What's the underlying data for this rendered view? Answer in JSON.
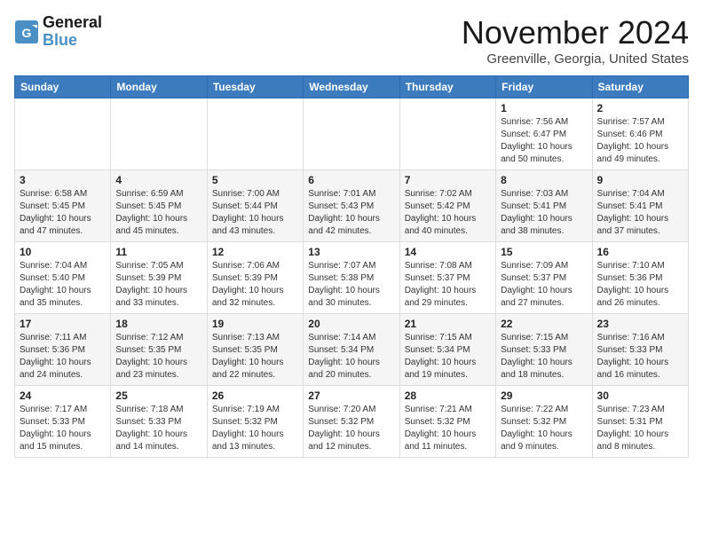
{
  "logo": {
    "line1": "General",
    "line2": "Blue"
  },
  "title": "November 2024",
  "location": "Greenville, Georgia, United States",
  "weekdays": [
    "Sunday",
    "Monday",
    "Tuesday",
    "Wednesday",
    "Thursday",
    "Friday",
    "Saturday"
  ],
  "weeks": [
    [
      {
        "day": "",
        "detail": ""
      },
      {
        "day": "",
        "detail": ""
      },
      {
        "day": "",
        "detail": ""
      },
      {
        "day": "",
        "detail": ""
      },
      {
        "day": "",
        "detail": ""
      },
      {
        "day": "1",
        "detail": "Sunrise: 7:56 AM\nSunset: 6:47 PM\nDaylight: 10 hours\nand 50 minutes."
      },
      {
        "day": "2",
        "detail": "Sunrise: 7:57 AM\nSunset: 6:46 PM\nDaylight: 10 hours\nand 49 minutes."
      }
    ],
    [
      {
        "day": "3",
        "detail": "Sunrise: 6:58 AM\nSunset: 5:45 PM\nDaylight: 10 hours\nand 47 minutes."
      },
      {
        "day": "4",
        "detail": "Sunrise: 6:59 AM\nSunset: 5:45 PM\nDaylight: 10 hours\nand 45 minutes."
      },
      {
        "day": "5",
        "detail": "Sunrise: 7:00 AM\nSunset: 5:44 PM\nDaylight: 10 hours\nand 43 minutes."
      },
      {
        "day": "6",
        "detail": "Sunrise: 7:01 AM\nSunset: 5:43 PM\nDaylight: 10 hours\nand 42 minutes."
      },
      {
        "day": "7",
        "detail": "Sunrise: 7:02 AM\nSunset: 5:42 PM\nDaylight: 10 hours\nand 40 minutes."
      },
      {
        "day": "8",
        "detail": "Sunrise: 7:03 AM\nSunset: 5:41 PM\nDaylight: 10 hours\nand 38 minutes."
      },
      {
        "day": "9",
        "detail": "Sunrise: 7:04 AM\nSunset: 5:41 PM\nDaylight: 10 hours\nand 37 minutes."
      }
    ],
    [
      {
        "day": "10",
        "detail": "Sunrise: 7:04 AM\nSunset: 5:40 PM\nDaylight: 10 hours\nand 35 minutes."
      },
      {
        "day": "11",
        "detail": "Sunrise: 7:05 AM\nSunset: 5:39 PM\nDaylight: 10 hours\nand 33 minutes."
      },
      {
        "day": "12",
        "detail": "Sunrise: 7:06 AM\nSunset: 5:39 PM\nDaylight: 10 hours\nand 32 minutes."
      },
      {
        "day": "13",
        "detail": "Sunrise: 7:07 AM\nSunset: 5:38 PM\nDaylight: 10 hours\nand 30 minutes."
      },
      {
        "day": "14",
        "detail": "Sunrise: 7:08 AM\nSunset: 5:37 PM\nDaylight: 10 hours\nand 29 minutes."
      },
      {
        "day": "15",
        "detail": "Sunrise: 7:09 AM\nSunset: 5:37 PM\nDaylight: 10 hours\nand 27 minutes."
      },
      {
        "day": "16",
        "detail": "Sunrise: 7:10 AM\nSunset: 5:36 PM\nDaylight: 10 hours\nand 26 minutes."
      }
    ],
    [
      {
        "day": "17",
        "detail": "Sunrise: 7:11 AM\nSunset: 5:36 PM\nDaylight: 10 hours\nand 24 minutes."
      },
      {
        "day": "18",
        "detail": "Sunrise: 7:12 AM\nSunset: 5:35 PM\nDaylight: 10 hours\nand 23 minutes."
      },
      {
        "day": "19",
        "detail": "Sunrise: 7:13 AM\nSunset: 5:35 PM\nDaylight: 10 hours\nand 22 minutes."
      },
      {
        "day": "20",
        "detail": "Sunrise: 7:14 AM\nSunset: 5:34 PM\nDaylight: 10 hours\nand 20 minutes."
      },
      {
        "day": "21",
        "detail": "Sunrise: 7:15 AM\nSunset: 5:34 PM\nDaylight: 10 hours\nand 19 minutes."
      },
      {
        "day": "22",
        "detail": "Sunrise: 7:15 AM\nSunset: 5:33 PM\nDaylight: 10 hours\nand 18 minutes."
      },
      {
        "day": "23",
        "detail": "Sunrise: 7:16 AM\nSunset: 5:33 PM\nDaylight: 10 hours\nand 16 minutes."
      }
    ],
    [
      {
        "day": "24",
        "detail": "Sunrise: 7:17 AM\nSunset: 5:33 PM\nDaylight: 10 hours\nand 15 minutes."
      },
      {
        "day": "25",
        "detail": "Sunrise: 7:18 AM\nSunset: 5:33 PM\nDaylight: 10 hours\nand 14 minutes."
      },
      {
        "day": "26",
        "detail": "Sunrise: 7:19 AM\nSunset: 5:32 PM\nDaylight: 10 hours\nand 13 minutes."
      },
      {
        "day": "27",
        "detail": "Sunrise: 7:20 AM\nSunset: 5:32 PM\nDaylight: 10 hours\nand 12 minutes."
      },
      {
        "day": "28",
        "detail": "Sunrise: 7:21 AM\nSunset: 5:32 PM\nDaylight: 10 hours\nand 11 minutes."
      },
      {
        "day": "29",
        "detail": "Sunrise: 7:22 AM\nSunset: 5:32 PM\nDaylight: 10 hours\nand 9 minutes."
      },
      {
        "day": "30",
        "detail": "Sunrise: 7:23 AM\nSunset: 5:31 PM\nDaylight: 10 hours\nand 8 minutes."
      }
    ]
  ]
}
